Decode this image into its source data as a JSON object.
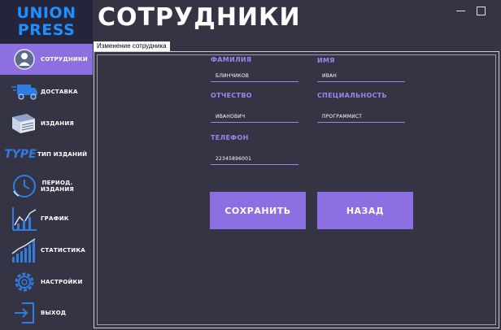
{
  "logo": {
    "line1": "UNION",
    "line2": "PRESS"
  },
  "header": {
    "title": "СОТРУДНИКИ"
  },
  "sidebar": {
    "items": [
      {
        "label": "СОТРУДНИКИ",
        "icon": "worker-icon",
        "active": true
      },
      {
        "label": "ДОСТАВКА",
        "icon": "delivery-truck-icon"
      },
      {
        "label": "ИЗДАНИЯ",
        "icon": "newspaper-icon"
      },
      {
        "label": "ТИП ИЗДАНИЙ",
        "icon": "type-text-icon",
        "icon_text": "TYPE"
      },
      {
        "label": "ПЕРИОД. ИЗДАНИЯ",
        "label_line1": "ПЕРИОД.",
        "label_line2": "ИЗДАНИЯ",
        "icon": "clock-icon"
      },
      {
        "label": "ГРАФИК",
        "icon": "chart-icon"
      },
      {
        "label": "СТАТИСТИКА",
        "icon": "stats-bars-icon"
      },
      {
        "label": "НАСТРОЙКИ",
        "icon": "gear-icon"
      },
      {
        "label": "ВЫХОД",
        "icon": "exit-icon"
      }
    ]
  },
  "tab": {
    "label": "Изменение сотрудника"
  },
  "form": {
    "surname": {
      "label": "ФАМИЛИЯ",
      "value": "БЛИНЧИКОВ"
    },
    "name": {
      "label": "ИМЯ",
      "value": "ИВАН"
    },
    "patronymic": {
      "label": "ОТЧЕСТВО",
      "value": "ИВАНОВИЧ"
    },
    "specialty": {
      "label": "СПЕЦИАЛЬНОСТЬ",
      "value": "ПРОГРАММИСТ"
    },
    "phone": {
      "label": "ТЕЛЕФОН",
      "value": "22345896001"
    },
    "save_label": "СОХРАНИТЬ",
    "back_label": "НАЗАД"
  },
  "colors": {
    "accent": "#8c6fe0",
    "background": "#343444",
    "logo": "#1e90ff"
  }
}
